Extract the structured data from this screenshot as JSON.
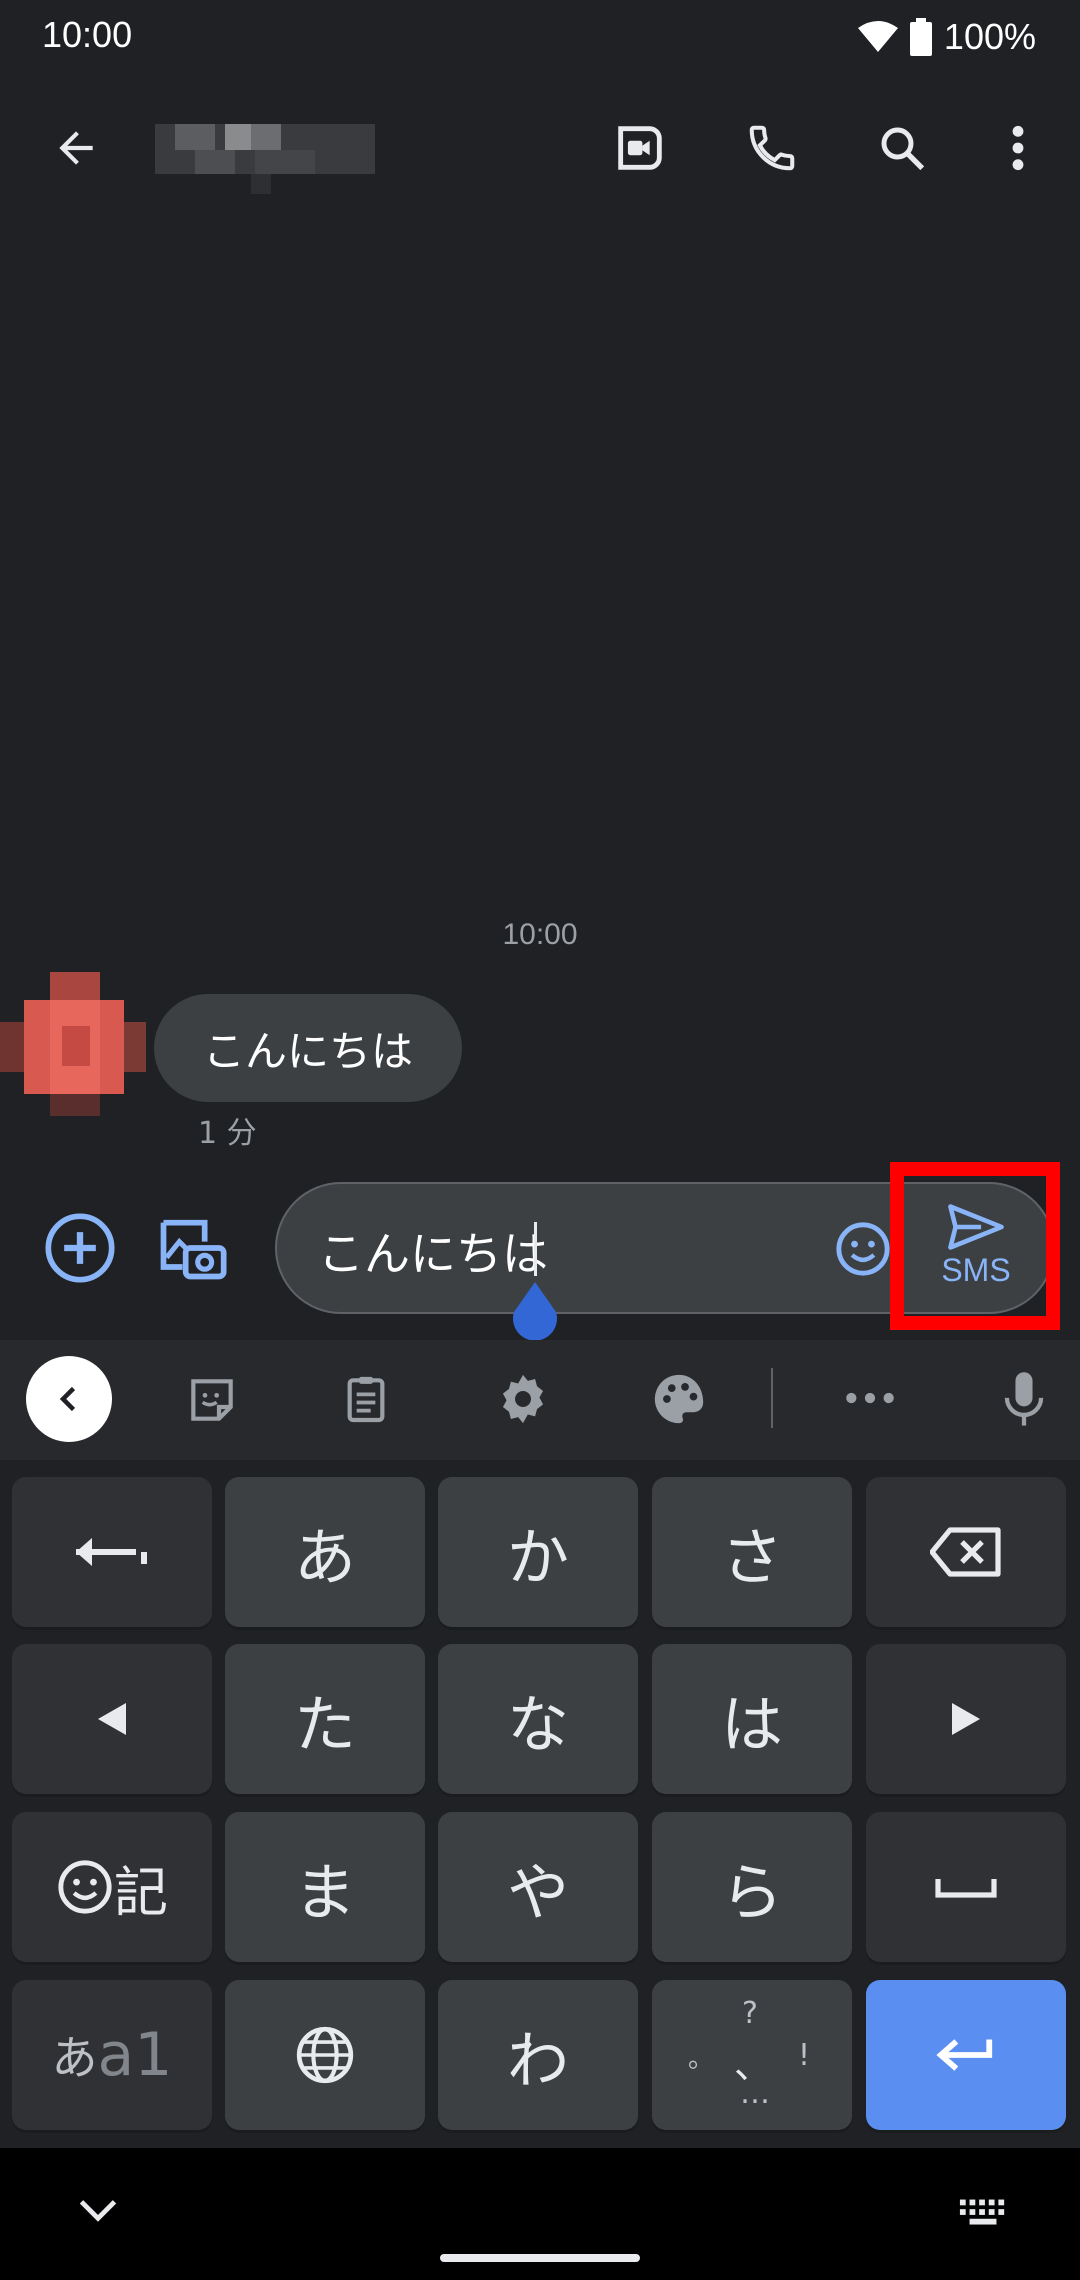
{
  "status_bar": {
    "time": "10:00",
    "battery_percent": "100%",
    "icons": [
      "wifi-icon",
      "battery-icon"
    ]
  },
  "toolbar": {
    "icons": [
      "back-arrow-icon",
      "video-call-icon",
      "phone-icon",
      "search-icon",
      "more-vert-icon"
    ]
  },
  "conversation": {
    "timestamp": "10:00",
    "messages": [
      {
        "text": "こんにちは",
        "meta": "1 分"
      }
    ]
  },
  "compose": {
    "text": "こんにちは",
    "icons": [
      "add-circle-icon",
      "gallery-camera-icon",
      "emoji-icon"
    ],
    "send_label": "SMS"
  },
  "keyboard": {
    "toolbar_icons": [
      "collapse-chevron-icon",
      "sticker-icon",
      "clipboard-icon",
      "settings-icon",
      "palette-icon",
      "more-horiz-icon",
      "mic-icon"
    ],
    "rows": [
      [
        "⟵",
        "あ",
        "か",
        "さ",
        "⌫"
      ],
      [
        "◀",
        "た",
        "な",
        "は",
        "▶"
      ],
      [
        "☺記",
        "ま",
        "や",
        "ら",
        "␣"
      ],
      [
        "あa1",
        "🌐",
        "わ",
        "？、。！",
        "↵"
      ]
    ],
    "keys": {
      "a": "あ",
      "ka": "か",
      "sa": "さ",
      "ta": "た",
      "na": "な",
      "ha": "は",
      "ma": "ま",
      "ya": "や",
      "ra": "ら",
      "wa": "わ",
      "kigou": "記",
      "mode_kana": "あ",
      "mode_alpha": "a1",
      "punct_top": "?",
      "punct_mid": "、",
      "punct_left": "。",
      "punct_right": "!",
      "punct_bottom": "…"
    }
  },
  "colors": {
    "background": "#202124",
    "accent": "#8ab4f8",
    "enter_key": "#5a8ef0",
    "highlight_box": "#ff0000"
  }
}
